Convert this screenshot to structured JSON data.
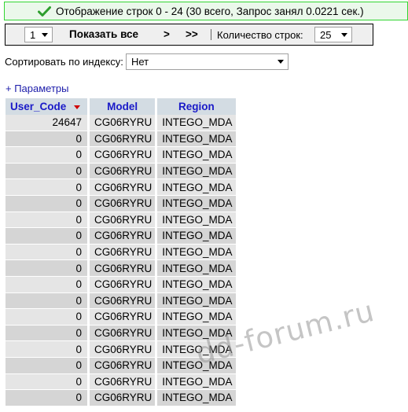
{
  "status": {
    "message": "Отображение строк 0 - 24 (30 всего, Запрос занял 0.0221 сек.)"
  },
  "nav": {
    "page_value": "1",
    "show_all": "Показать все",
    "next": ">",
    "last": ">>",
    "rowcount_label": "Количество строк:",
    "rowcount_value": "25"
  },
  "sort": {
    "label": "Сортировать по индексу:",
    "value": "Нет"
  },
  "params_link": "+ Параметры",
  "table": {
    "headers": [
      "User_Code",
      "Model",
      "Region"
    ],
    "rows": [
      [
        "24647",
        "CG06RYRU",
        "INTEGO_MDA"
      ],
      [
        "0",
        "CG06RYRU",
        "INTEGO_MDA"
      ],
      [
        "0",
        "CG06RYRU",
        "INTEGO_MDA"
      ],
      [
        "0",
        "CG06RYRU",
        "INTEGO_MDA"
      ],
      [
        "0",
        "CG06RYRU",
        "INTEGO_MDA"
      ],
      [
        "0",
        "CG06RYRU",
        "INTEGO_MDA"
      ],
      [
        "0",
        "CG06RYRU",
        "INTEGO_MDA"
      ],
      [
        "0",
        "CG06RYRU",
        "INTEGO_MDA"
      ],
      [
        "0",
        "CG06RYRU",
        "INTEGO_MDA"
      ],
      [
        "0",
        "CG06RYRU",
        "INTEGO_MDA"
      ],
      [
        "0",
        "CG06RYRU",
        "INTEGO_MDA"
      ],
      [
        "0",
        "CG06RYRU",
        "INTEGO_MDA"
      ],
      [
        "0",
        "CG06RYRU",
        "INTEGO_MDA"
      ],
      [
        "0",
        "CG06RYRU",
        "INTEGO_MDA"
      ],
      [
        "0",
        "CG06RYRU",
        "INTEGO_MDA"
      ],
      [
        "0",
        "CG06RYRU",
        "INTEGO_MDA"
      ],
      [
        "0",
        "CG06RYRU",
        "INTEGO_MDA"
      ],
      [
        "0",
        "CG06RYRU",
        "INTEGO_MDA"
      ]
    ]
  },
  "watermark": "dd-forum.ru",
  "colors": {
    "success_border": "#32d632",
    "success_bg": "#ebf8eb",
    "header_text": "#1a1ac8",
    "header_bg": "#d3dce3",
    "link": "#1c1caa"
  },
  "icons": {
    "status": "check-icon",
    "sort_direction": "sort-desc-icon"
  }
}
